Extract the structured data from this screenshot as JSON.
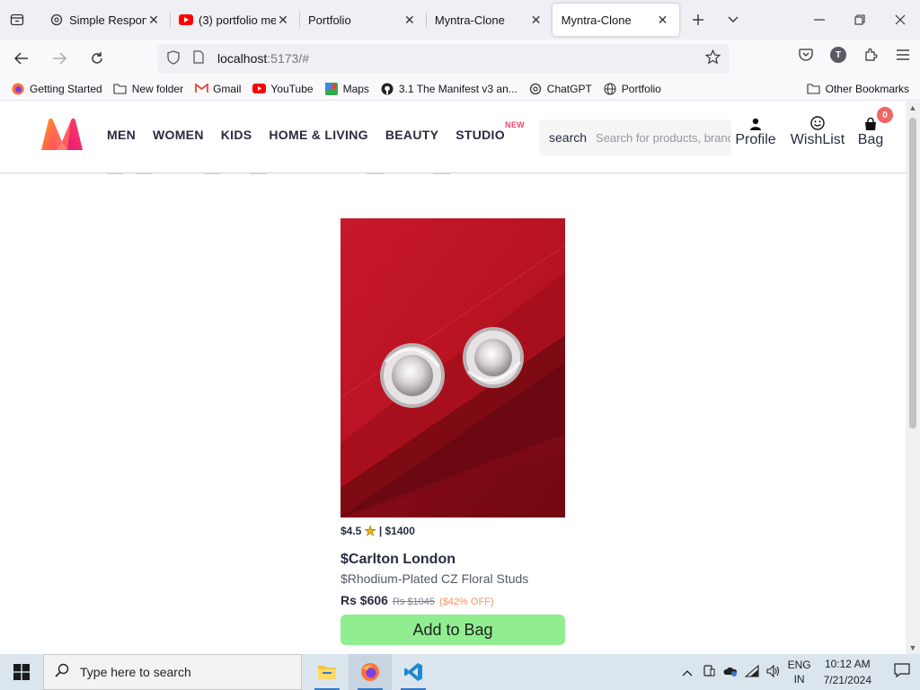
{
  "browser": {
    "tabs": [
      {
        "title": "Simple Responsi",
        "icon": "chatgpt-icon",
        "active": false
      },
      {
        "title": "(3) portfolio me",
        "icon": "youtube-icon",
        "active": false
      },
      {
        "title": "Portfolio",
        "icon": "",
        "active": false
      },
      {
        "title": "Myntra-Clone",
        "icon": "",
        "active": false
      },
      {
        "title": "Myntra-Clone",
        "icon": "",
        "active": true
      }
    ],
    "url": {
      "host": "localhost",
      "rest": ":5173/#"
    },
    "bookmarks": [
      {
        "label": "Getting Started",
        "icon": "firefox-icon"
      },
      {
        "label": "New folder",
        "icon": "folder-icon"
      },
      {
        "label": "Gmail",
        "icon": "gmail-icon"
      },
      {
        "label": "YouTube",
        "icon": "youtube-icon"
      },
      {
        "label": "Maps",
        "icon": "maps-icon"
      },
      {
        "label": "3.1 The Manifest v3 an...",
        "icon": "github-icon"
      },
      {
        "label": "ChatGPT",
        "icon": "chatgpt-icon"
      },
      {
        "label": "Portfolio",
        "icon": "globe-icon"
      }
    ],
    "other_bookmarks": "Other Bookmarks",
    "avatar_letter": "T"
  },
  "site": {
    "nav": [
      "MEN",
      "WOMEN",
      "KIDS",
      "HOME & LIVING",
      "BEAUTY",
      "STUDIO"
    ],
    "studio_badge": "NEW",
    "search_label": "search",
    "search_placeholder": "Search for products, brands and more",
    "actions": {
      "profile": "Profile",
      "wishlist": "WishList",
      "bag": "Bag",
      "bag_count": "0"
    },
    "colors": {
      "accent": "#ff3f6c",
      "add_button": "#90ee90",
      "badge": "#f16565",
      "discount": "#ff905a"
    }
  },
  "product": {
    "rating": "$4.5",
    "rating_count": "| $1400",
    "brand": "$Carlton London",
    "name": "$Rhodium-Plated CZ Floral Studs",
    "current_price": "Rs $606",
    "original_price": "Rs $1045",
    "discount": "($42% OFF)",
    "add_button": "Add to Bag"
  },
  "taskbar": {
    "search_placeholder": "Type here to search",
    "lang_1": "ENG",
    "lang_2": "IN",
    "time": "10:12 AM",
    "date": "7/21/2024"
  }
}
